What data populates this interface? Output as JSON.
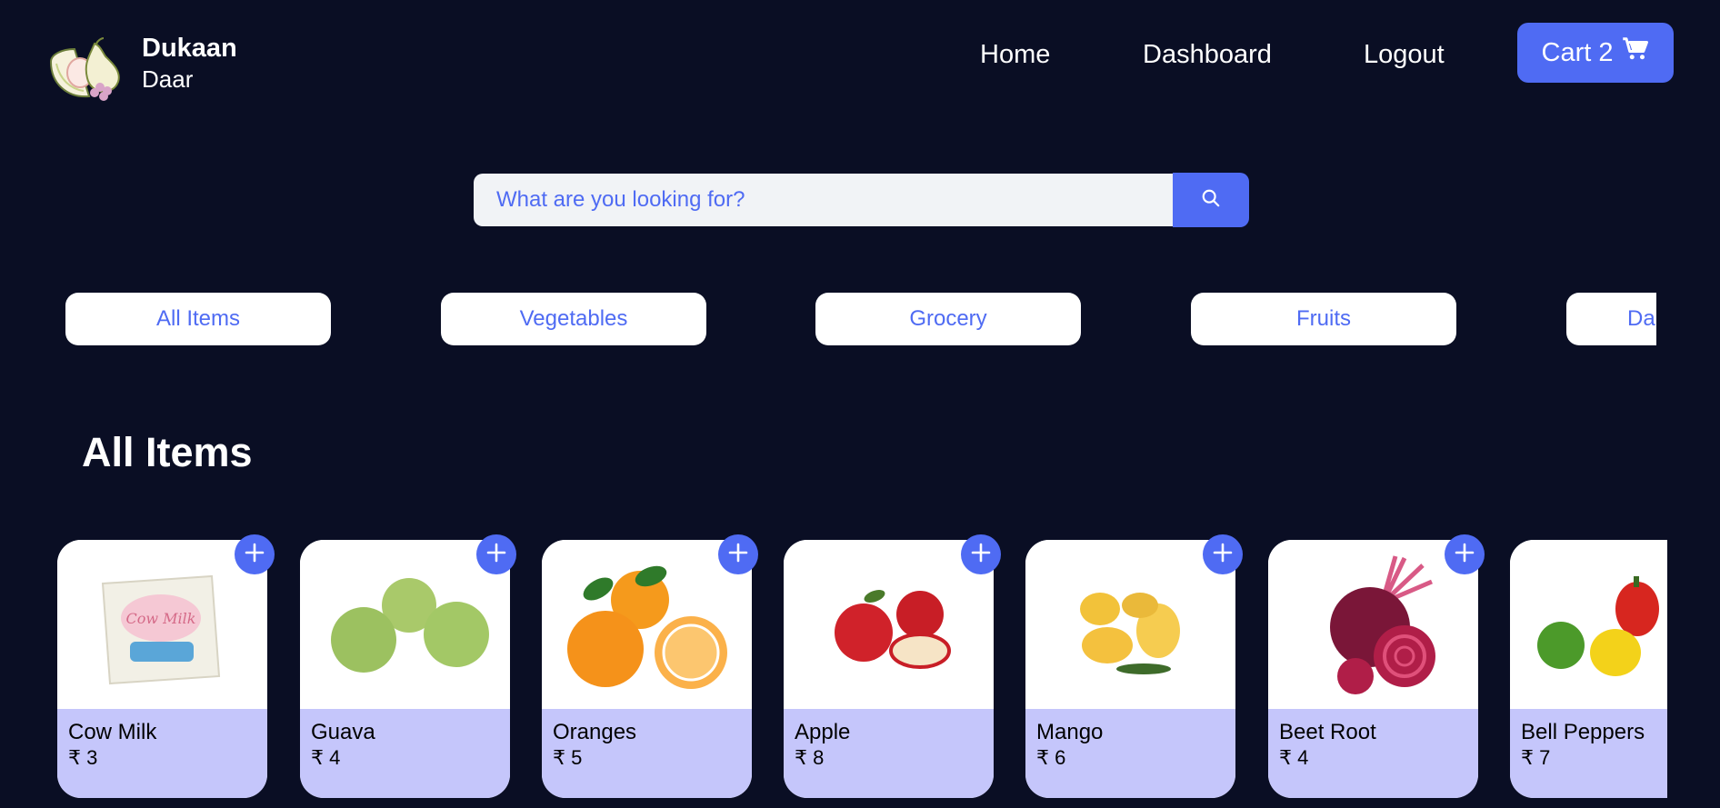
{
  "brand": {
    "title": "Dukaan",
    "subtitle": "Daar"
  },
  "nav": {
    "home": "Home",
    "dashboard": "Dashboard",
    "logout": "Logout",
    "cart_label": "Cart 2"
  },
  "search": {
    "placeholder": "What are you looking for?"
  },
  "categories": [
    "All Items",
    "Vegetables",
    "Grocery",
    "Fruits",
    "Dai"
  ],
  "section_title": "All Items",
  "products": [
    {
      "name": "Cow Milk",
      "price": "₹ 3"
    },
    {
      "name": "Guava",
      "price": "₹ 4"
    },
    {
      "name": "Oranges",
      "price": "₹ 5"
    },
    {
      "name": "Apple",
      "price": "₹ 8"
    },
    {
      "name": "Mango",
      "price": "₹ 6"
    },
    {
      "name": "Beet Root",
      "price": "₹ 4"
    },
    {
      "name": "Bell Peppers",
      "price": "₹ 7"
    }
  ],
  "colors": {
    "background": "#0a0e24",
    "accent": "#4f6bf3",
    "card_info": "#c5c6fb"
  },
  "icons": {
    "cart": "cart-icon",
    "search": "search-icon",
    "add": "plus-icon"
  }
}
